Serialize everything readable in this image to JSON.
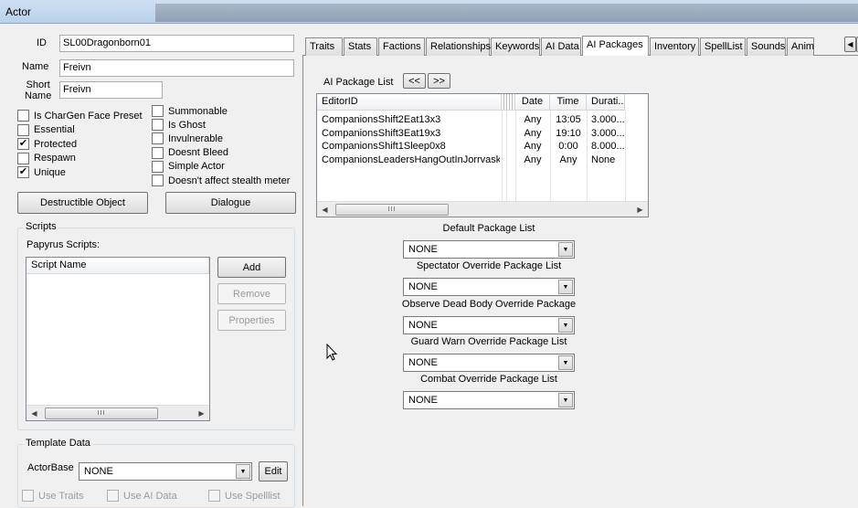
{
  "window": {
    "title": "Actor"
  },
  "fields": {
    "id_label": "ID",
    "id_value": "SL00Dragonborn01",
    "name_label": "Name",
    "name_value": "Freivn",
    "short_name_label": "Short\nName",
    "short_name_value": "Freivn"
  },
  "flags_left": [
    {
      "label": "Is CharGen Face Preset",
      "checked": false
    },
    {
      "label": "Essential",
      "checked": false
    },
    {
      "label": "Protected",
      "checked": true
    },
    {
      "label": "Respawn",
      "checked": false
    },
    {
      "label": "Unique",
      "checked": true
    }
  ],
  "flags_right": [
    {
      "label": "Summonable",
      "checked": false
    },
    {
      "label": "Is Ghost",
      "checked": false
    },
    {
      "label": "Invulnerable",
      "checked": false
    },
    {
      "label": "Doesnt Bleed",
      "checked": false
    },
    {
      "label": "Simple Actor",
      "checked": false
    },
    {
      "label": "Doesn't affect stealth meter",
      "checked": false
    }
  ],
  "buttons": {
    "destructible": "Destructible Object",
    "dialogue": "Dialogue"
  },
  "scripts": {
    "group_label": "Scripts",
    "papyrus_label": "Papyrus Scripts:",
    "column": "Script Name",
    "add": "Add",
    "remove": "Remove",
    "properties": "Properties"
  },
  "template": {
    "group_label": "Template Data",
    "actorbase_label": "ActorBase",
    "actorbase_value": "NONE",
    "edit": "Edit",
    "use_traits": "Use Traits",
    "use_ai_data": "Use AI Data",
    "use_spelllist": "Use Spelllist"
  },
  "tabs": [
    {
      "label": "Traits"
    },
    {
      "label": "Stats"
    },
    {
      "label": "Factions"
    },
    {
      "label": "Relationships"
    },
    {
      "label": "Keywords"
    },
    {
      "label": "AI Data"
    },
    {
      "label": "AI Packages"
    },
    {
      "label": "Inventory"
    },
    {
      "label": "SpellList"
    },
    {
      "label": "Sounds"
    },
    {
      "label": "Anim"
    }
  ],
  "active_tab": "AI Packages",
  "ai_packages": {
    "list_label": "AI Package List",
    "prev": "<<",
    "next": ">>",
    "columns": [
      "EditorID",
      "Date",
      "Time",
      "Durati..."
    ],
    "rows": [
      [
        "CompanionsShift2Eat13x3",
        "Any",
        "13:05",
        "3.000..."
      ],
      [
        "CompanionsShift3Eat19x3",
        "Any",
        "19:10",
        "3.000..."
      ],
      [
        "CompanionsShift1Sleep0x8",
        "Any",
        "0:00",
        "8.000..."
      ],
      [
        "CompanionsLeadersHangOutInJorrvaskr",
        "Any",
        "Any",
        "None"
      ]
    ],
    "package_lists": [
      {
        "label": "Default Package List",
        "value": "NONE"
      },
      {
        "label": "Spectator Override Package List",
        "value": "NONE"
      },
      {
        "label": "Observe Dead Body Override Package",
        "value": "NONE"
      },
      {
        "label": "Guard Warn Override Package List",
        "value": "NONE"
      },
      {
        "label": "Combat Override Package List",
        "value": "NONE"
      }
    ]
  },
  "scroll_thumb": "III"
}
